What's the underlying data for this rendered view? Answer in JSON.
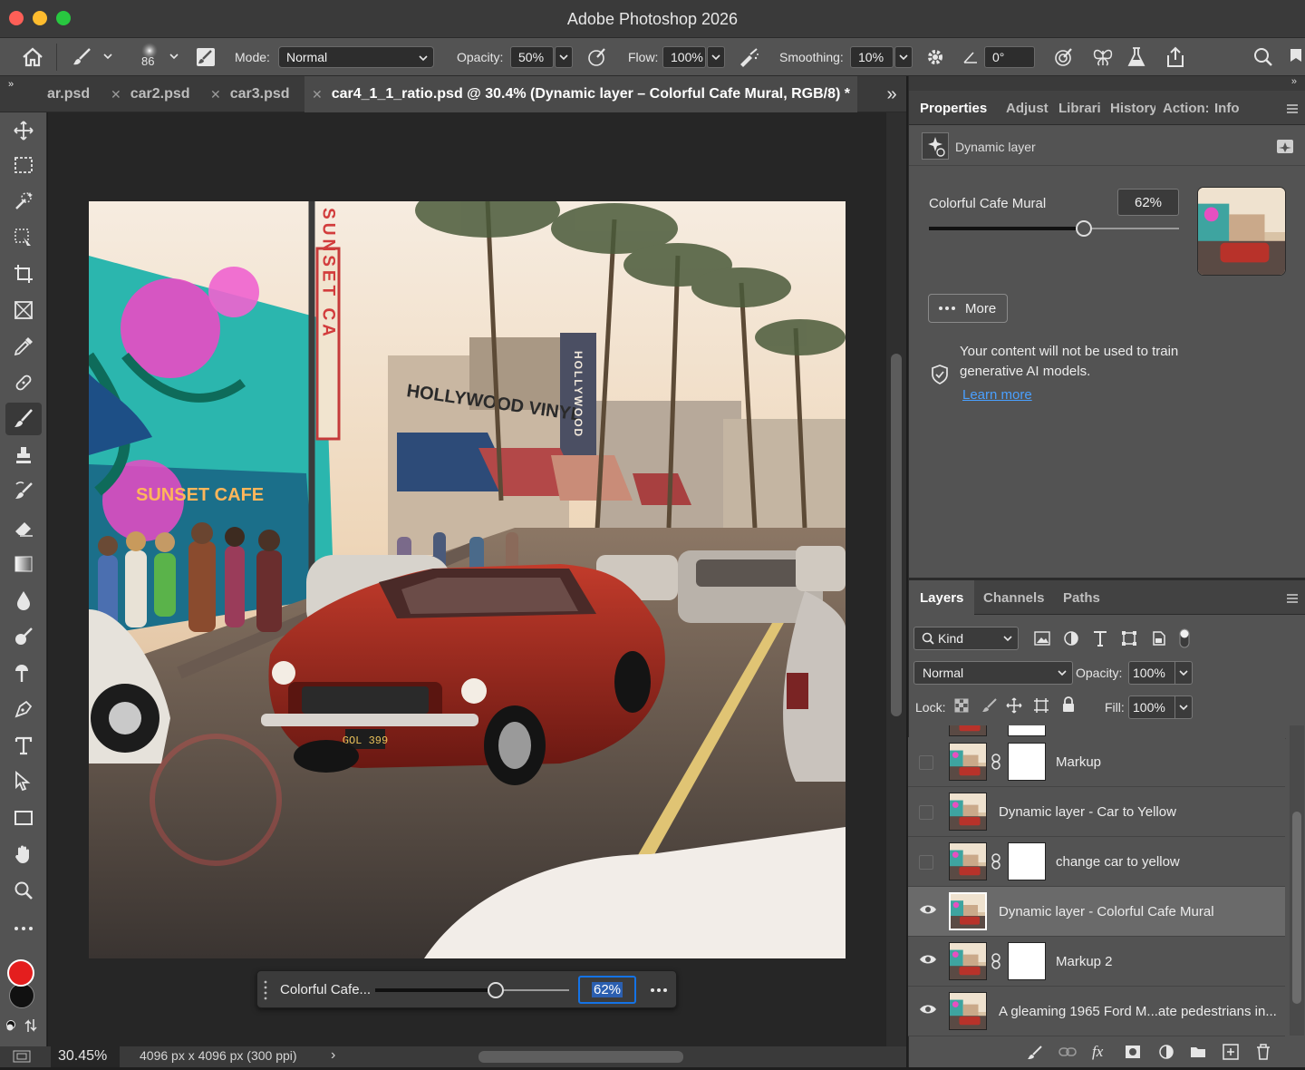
{
  "window": {
    "title": "Adobe Photoshop 2026"
  },
  "options_bar": {
    "brush_size": "86",
    "mode_label": "Mode:",
    "mode_value": "Normal",
    "opacity_label": "Opacity:",
    "opacity_value": "50%",
    "flow_label": "Flow:",
    "flow_value": "100%",
    "smoothing_label": "Smoothing:",
    "smoothing_value": "10%",
    "angle_value": "0°"
  },
  "doc_tabs": [
    {
      "label": "ar.psd",
      "active": false
    },
    {
      "label": "car2.psd",
      "active": false
    },
    {
      "label": "car3.psd",
      "active": false
    },
    {
      "label": "car4_1_1_ratio.psd @ 30.4% (Dynamic layer – Colorful Cafe Mural, RGB/8) *",
      "active": true
    }
  ],
  "canvas": {
    "sign_sunset": "SUNSET CA",
    "sign_hollywood_vinyl": "HOLLYWOOD VINYL",
    "sign_hollywood_vertical": "HOLLYWOOD",
    "sign_cafe": "SUNSET CAFE",
    "plate": "GOL 399"
  },
  "floating_bar": {
    "label": "Colorful Cafe...",
    "value": "62%",
    "value_fraction": 0.62
  },
  "status": {
    "zoom": "30.45%",
    "doc_size": "4096 px x 4096 px (300 ppi)",
    "arrow": "›"
  },
  "properties": {
    "tabs": [
      "Properties",
      "Adjust",
      "Librari",
      "History",
      "Action:",
      "Info"
    ],
    "layer_type": "Dynamic layer",
    "mural_label": "Colorful Cafe Mural",
    "mural_value": "62%",
    "more_label": "More",
    "notice": "Your content will not be used to train generative AI models.",
    "learn_more": "Learn more"
  },
  "layers_panel": {
    "tabs": [
      "Layers",
      "Channels",
      "Paths"
    ],
    "filter_kind": "Kind",
    "blend_mode": "Normal",
    "opacity_label": "Opacity:",
    "opacity_value": "100%",
    "lock_label": "Lock:",
    "fill_label": "Fill:",
    "fill_value": "100%",
    "layers": [
      {
        "name": "Markup",
        "visible": false,
        "has_mask": true,
        "active": false
      },
      {
        "name": "Dynamic layer - Car to Yellow",
        "visible": false,
        "has_mask": false,
        "active": false
      },
      {
        "name": "change car to yellow",
        "visible": false,
        "has_mask": true,
        "active": false
      },
      {
        "name": "Dynamic layer - Colorful Cafe Mural",
        "visible": true,
        "has_mask": false,
        "active": true
      },
      {
        "name": "Markup 2",
        "visible": true,
        "has_mask": true,
        "active": false
      },
      {
        "name": "A gleaming 1965 Ford M...ate pedestrians in...",
        "visible": true,
        "has_mask": false,
        "active": false
      }
    ]
  },
  "colors": {
    "foreground": "#e41e1e",
    "background": "#111111",
    "accent": "#1473e6"
  }
}
